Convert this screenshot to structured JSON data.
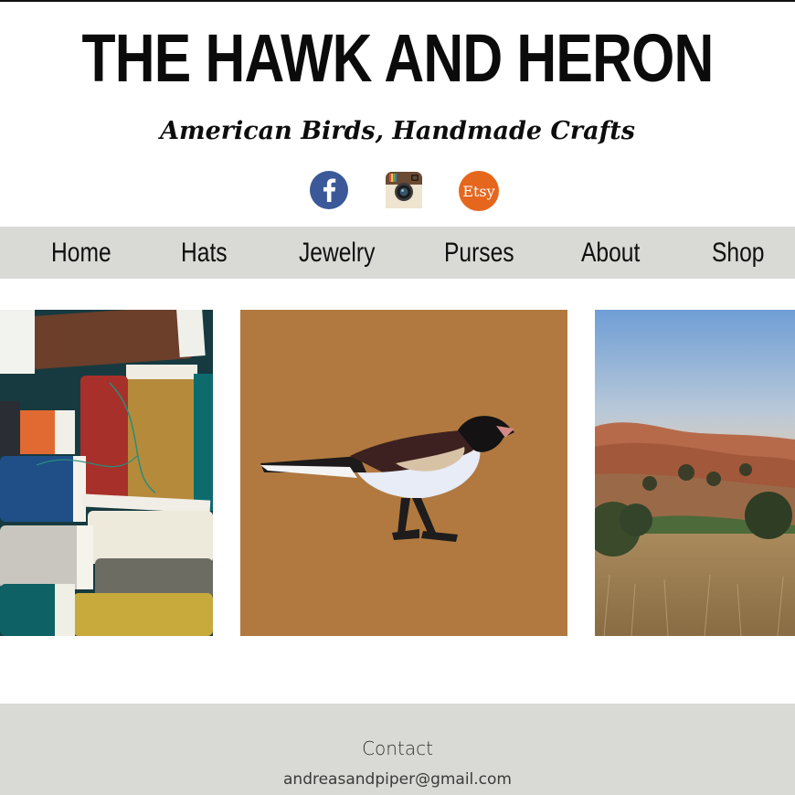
{
  "header": {
    "title": "THE HAWK AND HERON",
    "tagline": "American Birds, Handmade Crafts"
  },
  "social": [
    {
      "name": "facebook",
      "icon": "facebook-icon",
      "color": "#3b5998"
    },
    {
      "name": "instagram",
      "icon": "instagram-icon",
      "color": "#8a6a4a"
    },
    {
      "name": "etsy",
      "icon": "etsy-icon",
      "label": "Etsy",
      "color": "#e5671e"
    }
  ],
  "nav": {
    "items": [
      {
        "label": "Home"
      },
      {
        "label": "Hats"
      },
      {
        "label": "Jewelry"
      },
      {
        "label": "Purses"
      },
      {
        "label": "About"
      },
      {
        "label": "Shop"
      }
    ],
    "background": "#d9dad5"
  },
  "gallery": [
    {
      "subject": "spools of thread"
    },
    {
      "subject": "appliqued junco bird on tan fabric"
    },
    {
      "subject": "golden hillside landscape at dusk"
    }
  ],
  "footer": {
    "heading": "Contact",
    "email": "andreasandpiper@gmail.com"
  }
}
